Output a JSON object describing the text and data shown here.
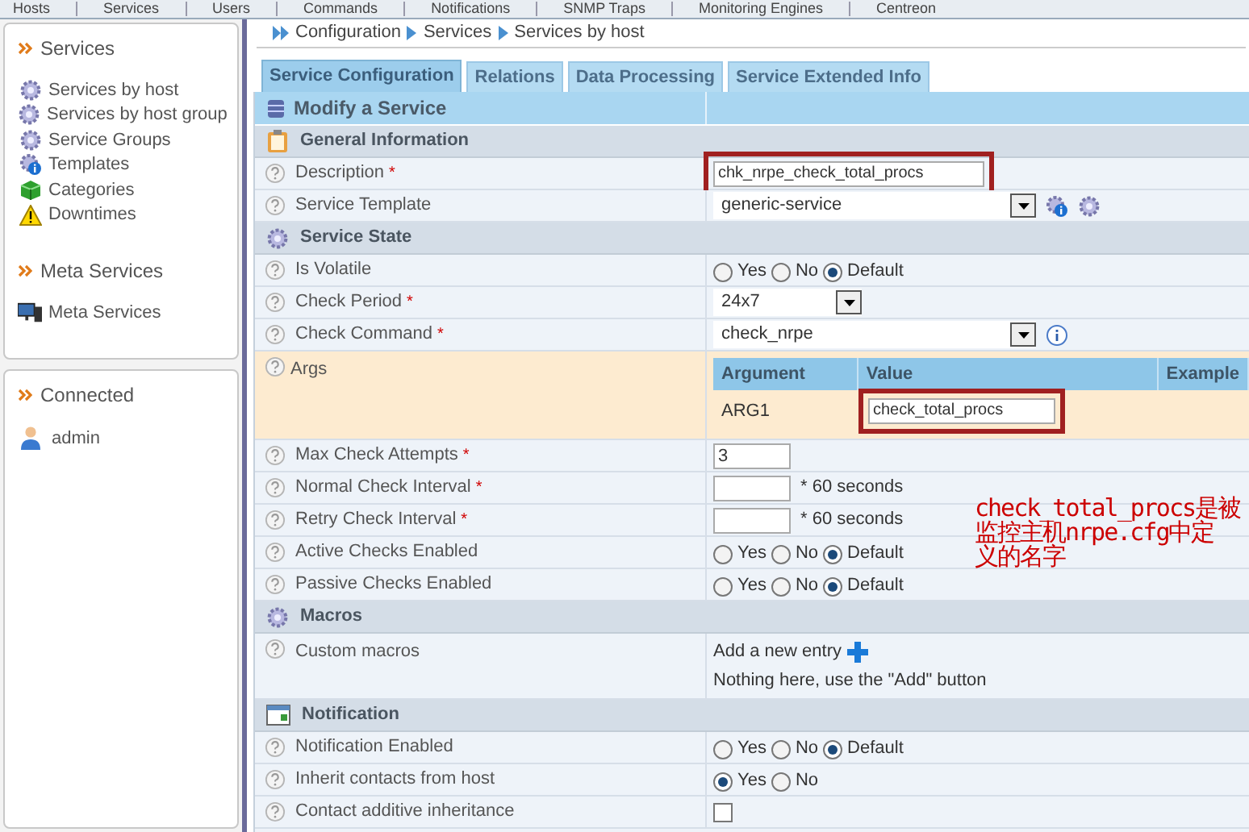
{
  "top_nav": [
    "Hosts",
    "Services",
    "Users",
    "Commands",
    "Notifications",
    "SNMP Traps",
    "Monitoring Engines",
    "Centreon"
  ],
  "sidebar": [
    {
      "title": "Services",
      "items": [
        {
          "label": "Services by host",
          "kind": "gear"
        },
        {
          "label": "Services by host group",
          "kind": "gear"
        },
        {
          "label": "Service Groups",
          "kind": "gears"
        },
        {
          "label": "Templates",
          "kind": "info_gear"
        },
        {
          "label": "Categories",
          "kind": "cube"
        },
        {
          "label": "Downtimes",
          "kind": "warning"
        }
      ]
    },
    {
      "title": "Meta Services",
      "items": [
        {
          "label": "Meta Services",
          "kind": "computer"
        }
      ]
    },
    {
      "title": "Connected",
      "items": [
        {
          "label": "admin",
          "kind": "user"
        }
      ]
    }
  ],
  "breadcrumb": [
    "Configuration",
    "Services",
    "Services by host"
  ],
  "tabs": [
    {
      "label": "Service Configuration",
      "selected": true
    },
    {
      "label": "Relations",
      "selected": false
    },
    {
      "label": "Data Processing",
      "selected": false
    },
    {
      "label": "Service Extended Info",
      "selected": false
    }
  ],
  "form": {
    "title": "Modify a Service",
    "sections": [
      {
        "title": "General Information",
        "kind": "clipboard",
        "rows": [
          {
            "label": "Description",
            "mark": "*",
            "kind": "text",
            "value": "chk_nrpe_check_total_procs",
            "highlighted": true
          },
          {
            "label": "Service Template",
            "kind": "select_template",
            "value": "generic-service"
          }
        ]
      },
      {
        "title": "Service State",
        "kind": "gear",
        "rows": [
          {
            "label": "Is Volatile",
            "kind": "radio",
            "options": [
              {
                "label": "Yes",
                "selected": false
              },
              {
                "label": "No",
                "selected": false
              },
              {
                "label": "Default",
                "selected": true
              }
            ]
          },
          {
            "label": "Check Period",
            "mark": "*",
            "kind": "select_short",
            "value": "24x7"
          },
          {
            "label": "Check Command",
            "mark": "*",
            "kind": "select_command",
            "value": "check_nrpe"
          },
          {
            "label": "Args",
            "kind": "args",
            "columns": [
              "Argument",
              "Value",
              "Example"
            ],
            "rows": [
              {
                "argument": "ARG1",
                "value": "check_total_procs",
                "highlighted": true
              }
            ]
          },
          {
            "label": "Max Check Attempts",
            "mark": "*",
            "kind": "text_short",
            "value": "3"
          },
          {
            "label": "Normal Check Interval",
            "mark": "*",
            "kind": "interval",
            "value": "",
            "suffix": "* 60 seconds"
          },
          {
            "label": "Retry Check Interval",
            "mark": "*",
            "kind": "interval",
            "value": "",
            "suffix": "* 60 seconds"
          },
          {
            "label": "Active Checks Enabled",
            "kind": "radio",
            "options": [
              {
                "label": "Yes",
                "selected": false
              },
              {
                "label": "No",
                "selected": false
              },
              {
                "label": "Default",
                "selected": true
              }
            ]
          },
          {
            "label": "Passive Checks Enabled",
            "kind": "radio",
            "options": [
              {
                "label": "Yes",
                "selected": false
              },
              {
                "label": "No",
                "selected": false
              },
              {
                "label": "Default",
                "selected": true
              }
            ]
          }
        ]
      },
      {
        "title": "Macros",
        "kind": "gears",
        "rows": [
          {
            "label": "Custom macros",
            "kind": "macros",
            "link": "Add a new entry",
            "note": "Nothing here, use the \"Add\" button"
          }
        ]
      },
      {
        "title": "Notification",
        "kind": "window",
        "rows": [
          {
            "label": "Notification Enabled",
            "kind": "radio",
            "options": [
              {
                "label": "Yes",
                "selected": false
              },
              {
                "label": "No",
                "selected": false
              },
              {
                "label": "Default",
                "selected": true
              }
            ]
          },
          {
            "label": "Inherit contacts from host",
            "kind": "radio",
            "options": [
              {
                "label": "Yes",
                "selected": true
              },
              {
                "label": "No",
                "selected": false
              }
            ]
          },
          {
            "label": "Contact additive inheritance",
            "kind": "checkbox",
            "checked": false
          }
        ]
      }
    ]
  },
  "annotation": {
    "lines": [
      "check_total_procs是被",
      "监控主机nrpe.cfg中定",
      "义的名字"
    ],
    "color": "#cc0000"
  }
}
